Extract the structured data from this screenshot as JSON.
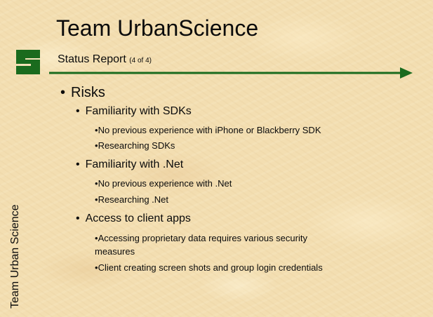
{
  "slide": {
    "title": "Team UrbanScience",
    "subtitle_main": "Status Report",
    "subtitle_small": "(4 of 4)",
    "side_label": "Team Urban Science",
    "logo_icon": "msu-s-logo-icon",
    "accent_color": "#1a6b1e",
    "bullet_glyph": "•",
    "outline": {
      "heading": "Risks",
      "groups": [
        {
          "label": "Familiarity with SDKs",
          "items": [
            "No previous experience with iPhone or Blackberry SDK",
            "Researching SDKs"
          ]
        },
        {
          "label": "Familiarity with .Net",
          "items": [
            "No previous experience with .Net",
            "Researching .Net"
          ]
        },
        {
          "label": "Access to client apps",
          "items": [
            "Accessing proprietary data requires various security",
            "measures",
            "Client creating screen shots and group login credentials"
          ]
        }
      ]
    }
  }
}
